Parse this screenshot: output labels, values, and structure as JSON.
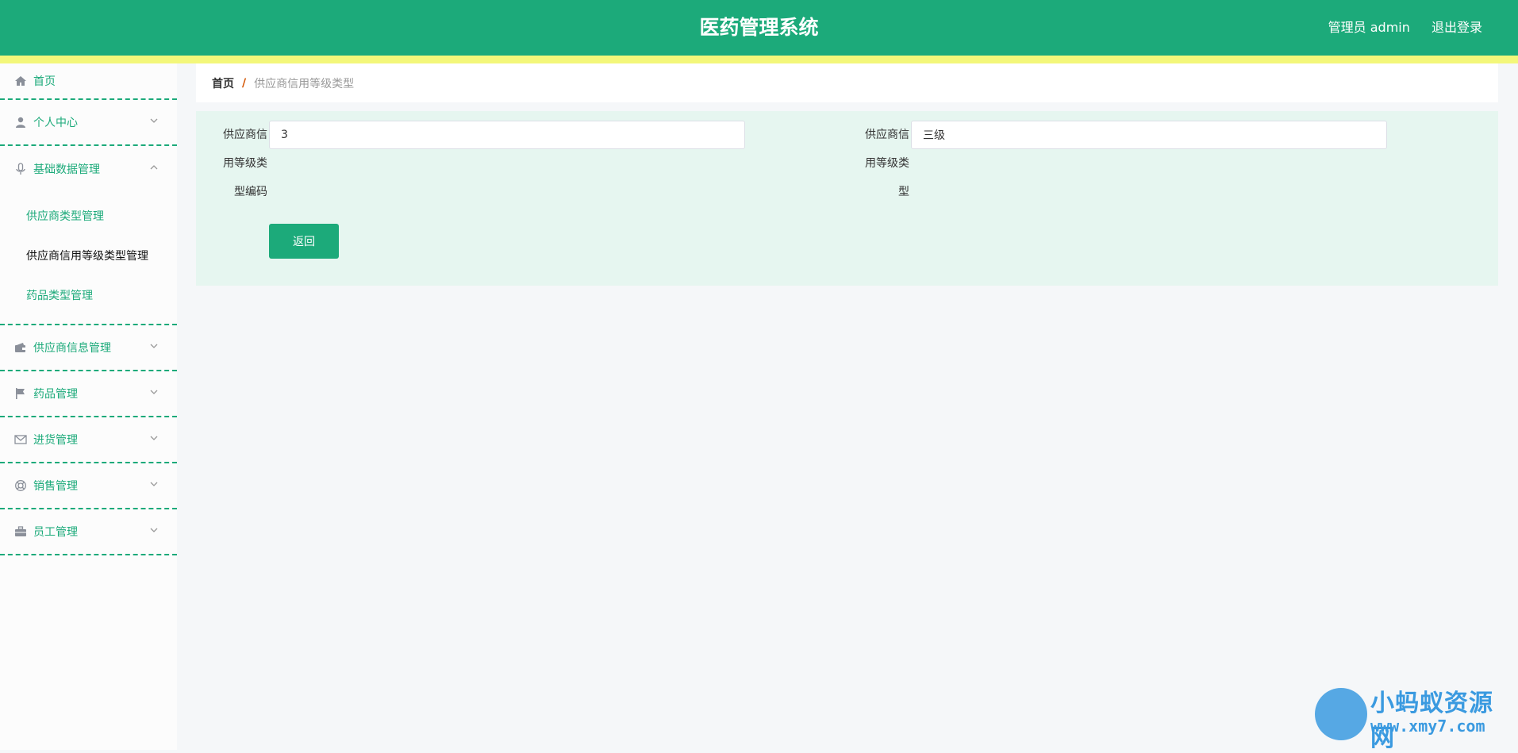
{
  "header": {
    "title": "医药管理系统",
    "user_label": "管理员 admin",
    "logout_label": "退出登录",
    "color": "#1caa7a",
    "stripe_color": "#f3f77a"
  },
  "sidebar": {
    "home": {
      "label": "首页",
      "icon": "home-icon"
    },
    "groups": [
      {
        "label": "个人中心",
        "icon": "user-icon"
      },
      {
        "label": "基础数据管理",
        "icon": "microphone-icon",
        "items": [
          "供应商类型管理",
          "供应商信用等级类型管理",
          "药品类型管理"
        ],
        "active_item": "供应商信用等级类型管理"
      },
      {
        "label": "供应商信息管理",
        "icon": "wallet-icon"
      },
      {
        "label": "药品管理",
        "icon": "flag-icon"
      },
      {
        "label": "进货管理",
        "icon": "mail-icon"
      },
      {
        "label": "销售管理",
        "icon": "lifebuoy-icon"
      },
      {
        "label": "员工管理",
        "icon": "briefcase-icon"
      }
    ]
  },
  "breadcrumb": {
    "home": "首页",
    "separator": "/",
    "current": "供应商信用等级类型"
  },
  "form": {
    "field1": {
      "label_lines": [
        "供应商信",
        "用等级类",
        "型编码"
      ],
      "value": "3"
    },
    "field2": {
      "label_lines": [
        "供应商信",
        "用等级类",
        "型"
      ],
      "value": "三级"
    },
    "back_label": "返回"
  },
  "watermark": {
    "name": "小蚂蚁资源网",
    "url": "www.xmy7.com"
  }
}
